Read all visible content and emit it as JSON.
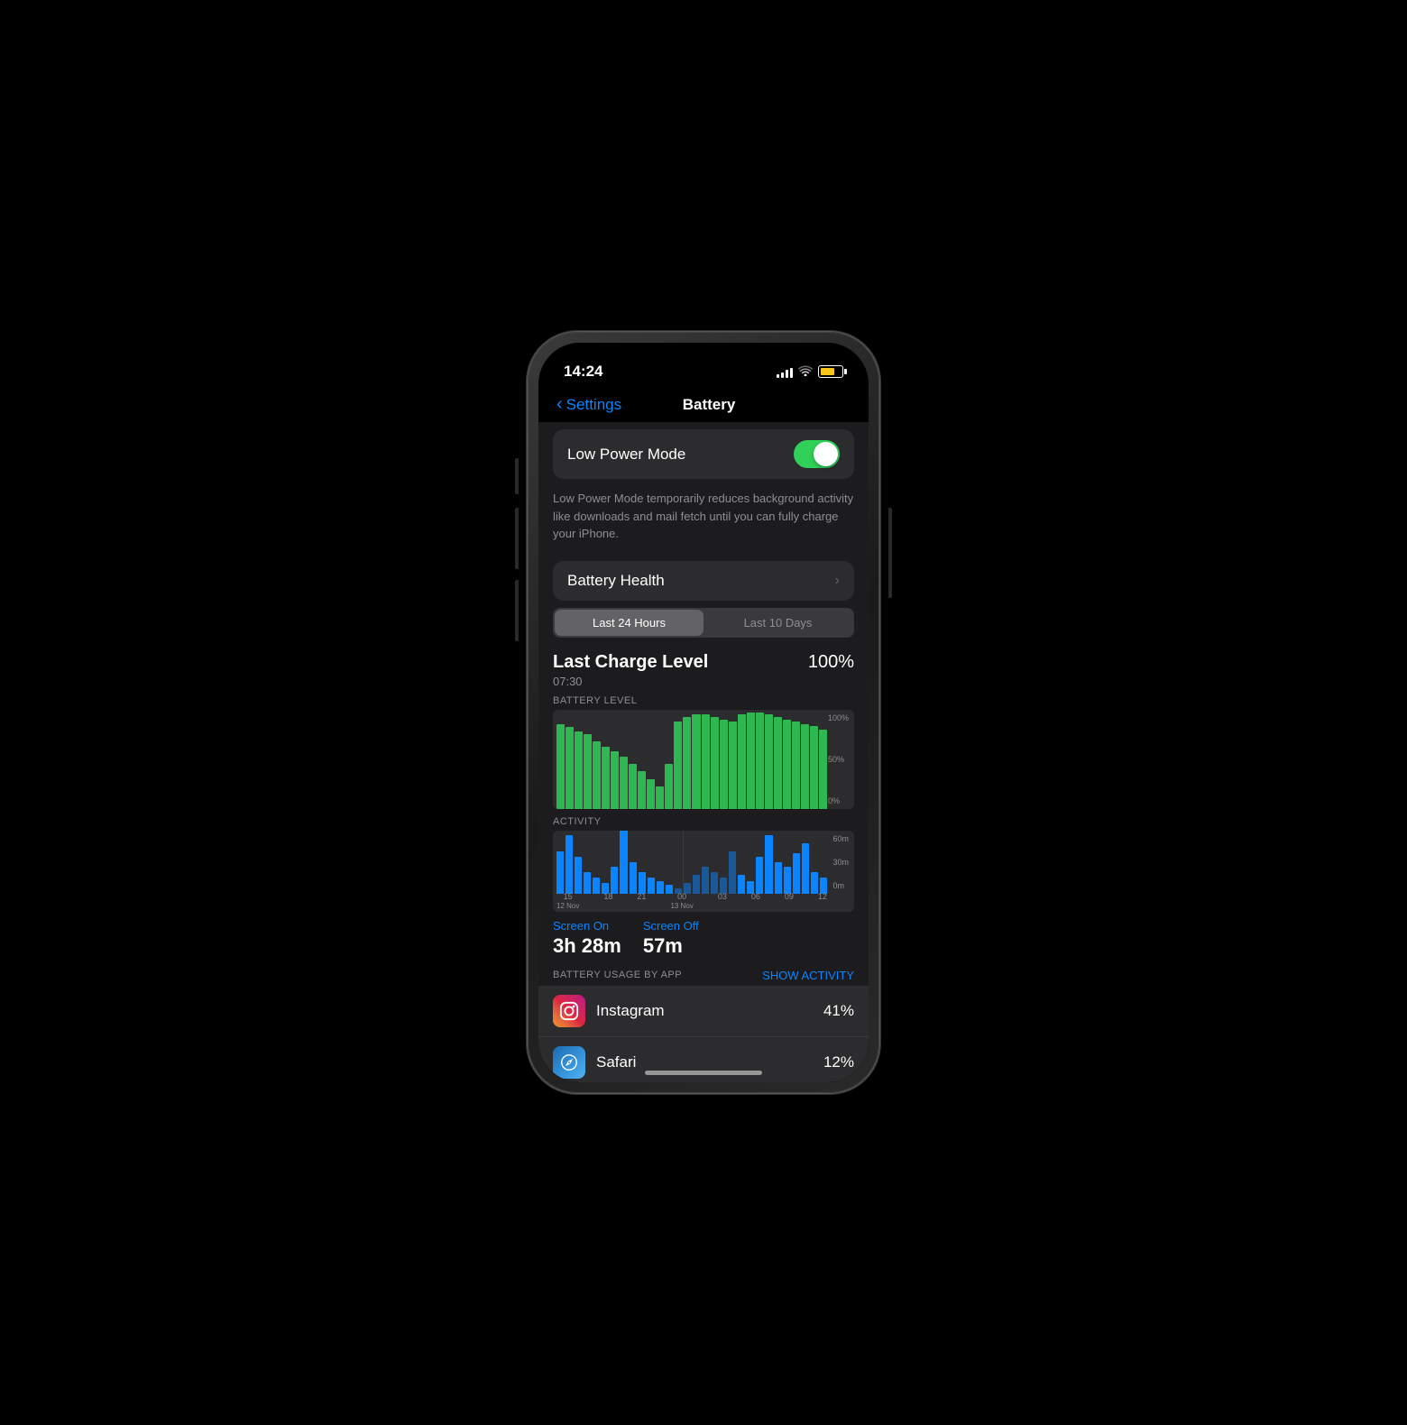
{
  "status_bar": {
    "time": "14:24",
    "signal_bars": [
      3,
      5,
      8,
      11,
      13
    ],
    "battery_level_percent": 70
  },
  "nav": {
    "back_label": "Settings",
    "title": "Battery"
  },
  "low_power_mode": {
    "label": "Low Power Mode",
    "enabled": true,
    "description": "Low Power Mode temporarily reduces background activity like downloads and mail fetch until you can fully charge your iPhone."
  },
  "battery_health": {
    "label": "Battery Health"
  },
  "tabs": {
    "tab1": "Last 24 Hours",
    "tab2": "Last 10 Days",
    "active": "tab1"
  },
  "last_charge": {
    "title": "Last Charge Level",
    "time": "07:30",
    "percent": "100%"
  },
  "battery_level_chart": {
    "label": "BATTERY LEVEL",
    "y_labels": [
      "100%",
      "50%",
      "0%"
    ],
    "bars": [
      85,
      82,
      78,
      75,
      68,
      62,
      58,
      52,
      45,
      38,
      30,
      22,
      45,
      88,
      92,
      95,
      95,
      92,
      90,
      88,
      95,
      97,
      97,
      95,
      92,
      90,
      88,
      85,
      83,
      80
    ]
  },
  "activity_chart": {
    "label": "ACTIVITY",
    "y_labels": [
      "60m",
      "30m",
      "0m"
    ],
    "x_labels": [
      "15",
      "18",
      "21",
      "00",
      "03",
      "06",
      "09",
      "12"
    ],
    "x_sub_labels": [
      "12 Nov",
      "",
      "",
      "13 Nov",
      "",
      "",
      "",
      ""
    ],
    "bars": [
      40,
      55,
      35,
      20,
      15,
      10,
      25,
      70,
      30,
      20,
      15,
      12,
      8,
      5,
      10,
      18,
      25,
      20,
      15,
      40,
      18,
      12,
      35,
      55,
      30,
      25,
      38,
      48,
      20,
      15
    ],
    "divider_position": 0.43
  },
  "screen_usage": {
    "screen_on_label": "Screen On",
    "screen_on_value": "3h 28m",
    "screen_off_label": "Screen Off",
    "screen_off_value": "57m"
  },
  "battery_usage": {
    "header": "BATTERY USAGE BY APP",
    "show_activity": "SHOW ACTIVITY",
    "apps": [
      {
        "name": "Instagram",
        "percent": "41%",
        "icon": "instagram"
      },
      {
        "name": "Safari",
        "percent": "12%",
        "icon": "safari"
      }
    ]
  }
}
